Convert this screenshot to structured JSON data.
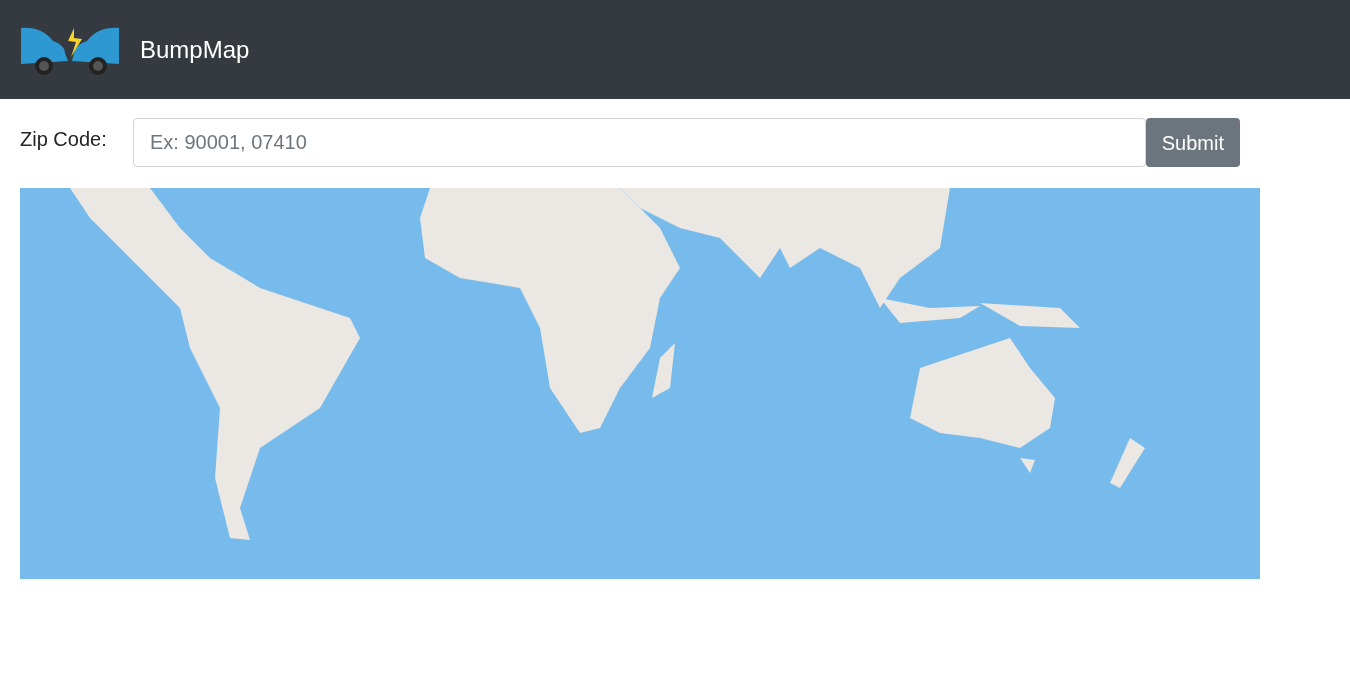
{
  "navbar": {
    "title": "BumpMap"
  },
  "form": {
    "label": "Zip Code:",
    "placeholder": "Ex: 90001, 07410",
    "button": "Submit"
  }
}
